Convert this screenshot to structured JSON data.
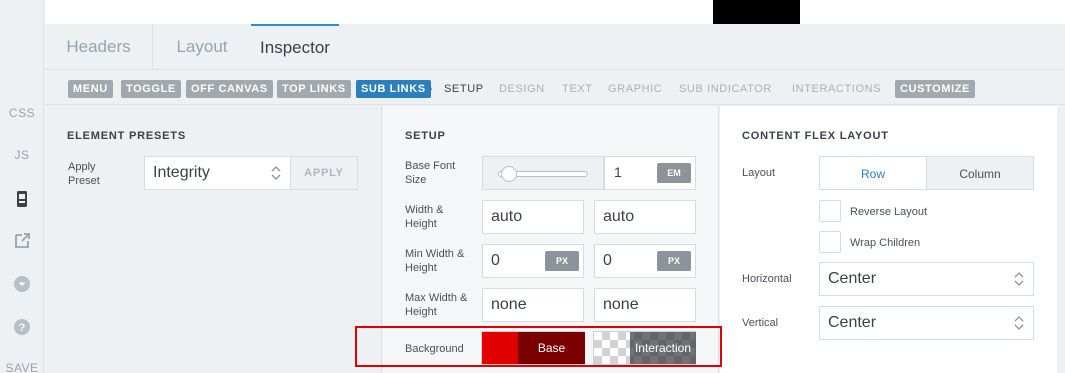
{
  "rail": {
    "css_label": "CSS",
    "js_label": "JS",
    "save_label": "SAVE"
  },
  "tabs": [
    {
      "label": "Headers"
    },
    {
      "label": "Layout"
    },
    {
      "label": "Inspector"
    }
  ],
  "subnav": {
    "items": [
      "MENU",
      "TOGGLE",
      "OFF CANVAS",
      "TOP LINKS",
      "SUB LINKS",
      "SETUP",
      "DESIGN",
      "TEXT",
      "GRAPHIC",
      "SUB INDICATOR",
      "INTERACTIONS",
      "CUSTOMIZE"
    ],
    "active": "SUB LINKS",
    "current": "SETUP"
  },
  "element_presets": {
    "title": "ELEMENT PRESETS",
    "apply_preset_label": "Apply Preset",
    "preset_value": "Integrity",
    "apply_button": "APPLY"
  },
  "setup": {
    "title": "SETUP",
    "base_font_size_label": "Base Font Size",
    "base_font_size_value": "1",
    "base_font_size_unit": "EM",
    "slider_level": 0.12,
    "width_height_label": "Width & Height",
    "width_value": "auto",
    "height_value": "auto",
    "min_wh_label": "Min Width & Height",
    "min_width_value": "0",
    "min_height_value": "0",
    "px_unit": "PX",
    "max_wh_label": "Max Width & Height",
    "max_width_value": "none",
    "max_height_value": "none",
    "background_label": "Background",
    "base_label": "Base",
    "interaction_label": "Interaction",
    "base_color": "#e00000"
  },
  "content_flex": {
    "title": "CONTENT FLEX LAYOUT",
    "layout_label": "Layout",
    "row_label": "Row",
    "column_label": "Column",
    "reverse_label": "Reverse Layout",
    "wrap_label": "Wrap Children",
    "horizontal_label": "Horizontal",
    "horizontal_value": "Center",
    "vertical_label": "Vertical",
    "vertical_value": "Center"
  },
  "colors": {
    "accent": "#2a7fbc",
    "highlight": "#e00000"
  }
}
